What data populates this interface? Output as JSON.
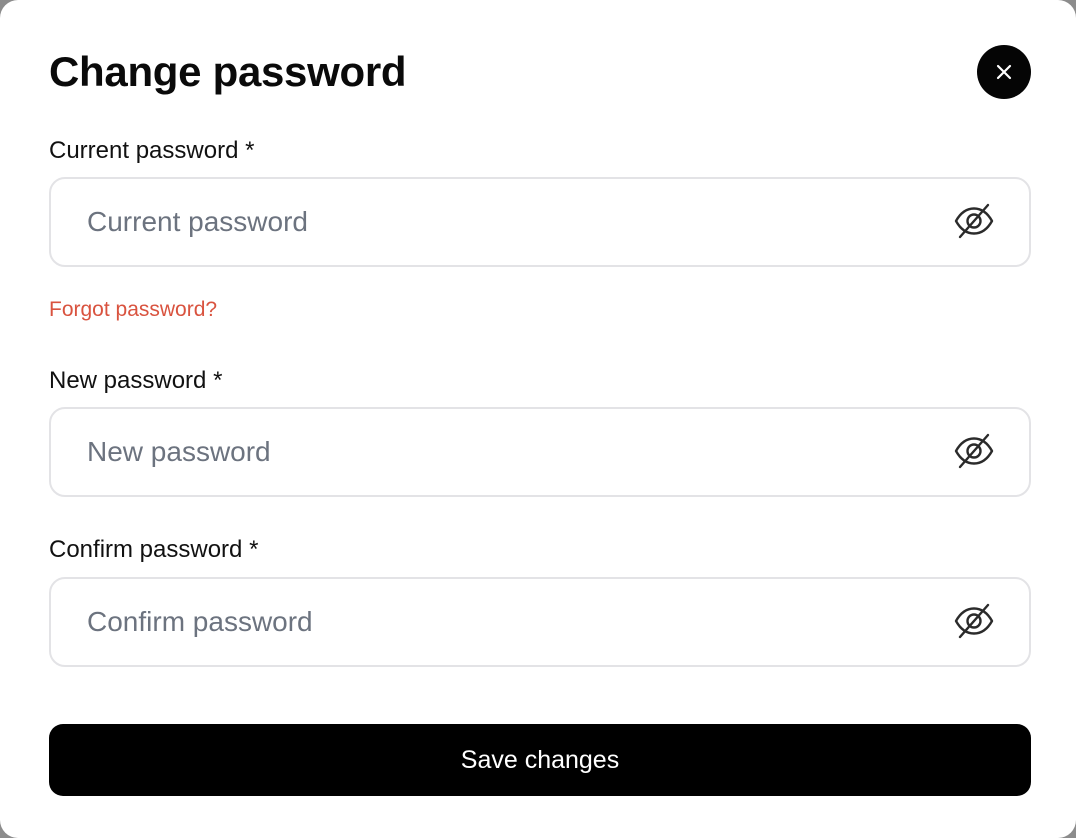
{
  "dialog": {
    "title": "Change password",
    "close_icon": "close-icon"
  },
  "fields": {
    "current": {
      "label": "Current password *",
      "placeholder": "Current password",
      "value": "",
      "toggle_icon": "eye-off-icon"
    },
    "new": {
      "label": "New password *",
      "placeholder": "New password",
      "value": "",
      "toggle_icon": "eye-off-icon"
    },
    "confirm": {
      "label": "Confirm password *",
      "placeholder": "Confirm password",
      "value": "",
      "toggle_icon": "eye-off-icon"
    }
  },
  "forgot_link": "Forgot password?",
  "save_label": "Save changes",
  "colors": {
    "primary": "#000000",
    "link": "#d9533f",
    "border": "#e3e3e6",
    "placeholder": "#6c737f"
  }
}
